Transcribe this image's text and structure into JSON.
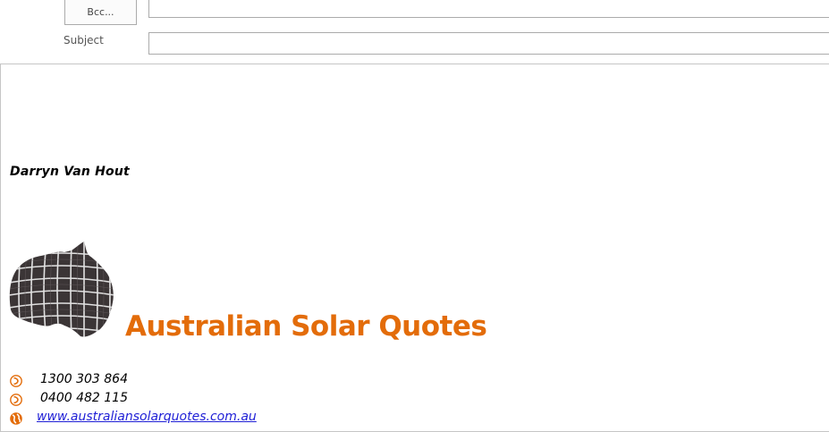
{
  "header": {
    "bcc_label": "Bcc...",
    "bcc_value": "",
    "subject_label": "Subject",
    "subject_value": ""
  },
  "signature": {
    "name": "Darryn Van Hout",
    "company": "Australian Solar Quotes",
    "phone1": "1300 303 864",
    "phone2": "0400 482 115",
    "website": "www.australiansolarquotes.com.au",
    "logo_icon": "australia-solar-panel-logo",
    "phone_icon": "phone-icon",
    "web_icon": "globe-icon"
  },
  "colors": {
    "brand_orange": "#e36c0a",
    "link_blue": "#1f1fd6"
  }
}
